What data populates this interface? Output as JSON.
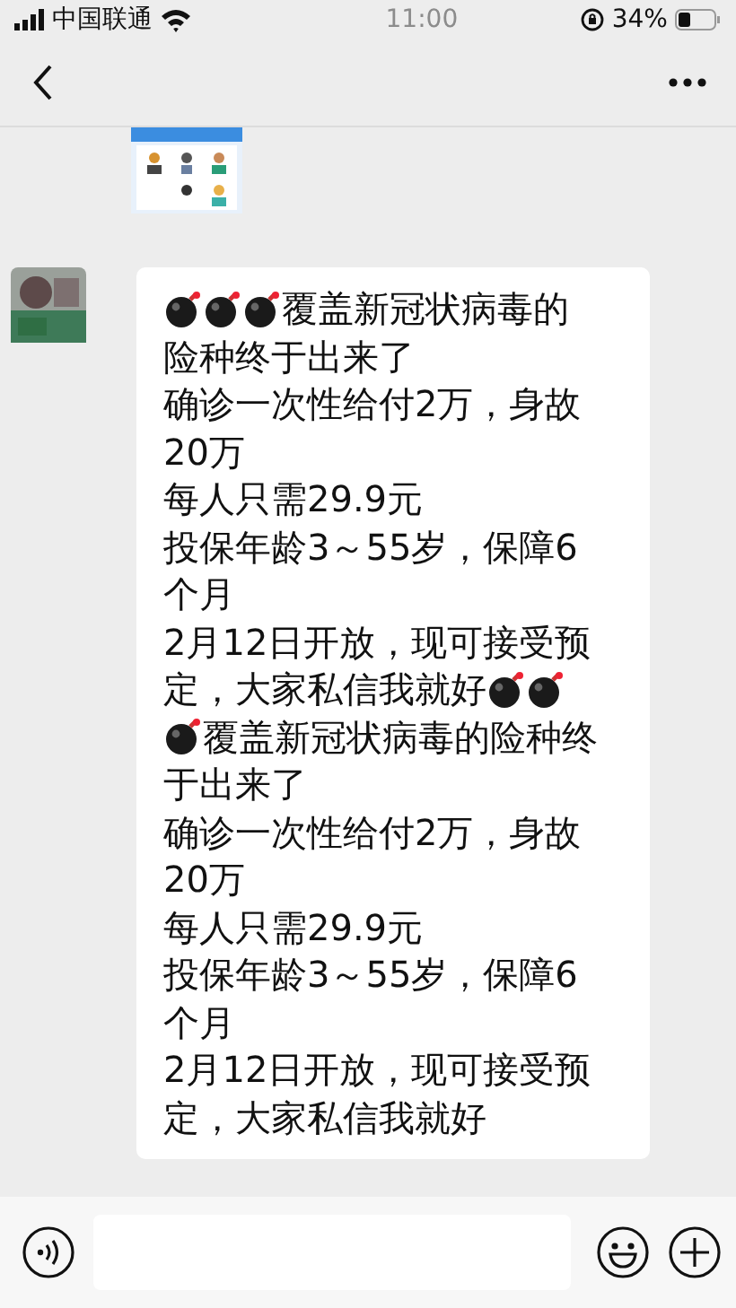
{
  "status_bar": {
    "carrier": "中国联通",
    "time": "11:00",
    "battery": "34%"
  },
  "chat": {
    "shared_image": {
      "kind": "picture"
    },
    "sender_avatar": {
      "kind": "picture"
    },
    "message_lines": [
      [
        {
          "kind": "bomb"
        },
        {
          "kind": "bomb"
        },
        {
          "kind": "bomb"
        },
        {
          "kind": "text",
          "text": "覆盖新冠状病毒的"
        }
      ],
      [
        {
          "kind": "text",
          "text": "险种终于出来了"
        }
      ],
      [
        {
          "kind": "text",
          "text": "确诊一次性给付2万，身故"
        }
      ],
      [
        {
          "kind": "text",
          "text": "20万"
        }
      ],
      [
        {
          "kind": "text",
          "text": "每人只需29.9元"
        }
      ],
      [
        {
          "kind": "text",
          "text": "投保年龄3～55岁，保障6"
        }
      ],
      [
        {
          "kind": "text",
          "text": "个月"
        }
      ],
      [
        {
          "kind": "text",
          "text": "2月12日开放，现可接受预"
        }
      ],
      [
        {
          "kind": "text",
          "text": "定，大家私信我就好"
        },
        {
          "kind": "bomb"
        },
        {
          "kind": "bomb"
        }
      ],
      [
        {
          "kind": "bomb"
        },
        {
          "kind": "text",
          "text": "覆盖新冠状病毒的险种终"
        }
      ],
      [
        {
          "kind": "text",
          "text": "于出来了"
        }
      ],
      [
        {
          "kind": "text",
          "text": "确诊一次性给付2万，身故"
        }
      ],
      [
        {
          "kind": "text",
          "text": "20万"
        }
      ],
      [
        {
          "kind": "text",
          "text": "每人只需29.9元"
        }
      ],
      [
        {
          "kind": "text",
          "text": "投保年龄3～55岁，保障6"
        }
      ],
      [
        {
          "kind": "text",
          "text": "个月"
        }
      ],
      [
        {
          "kind": "text",
          "text": "2月12日开放，现可接受预"
        }
      ],
      [
        {
          "kind": "text",
          "text": "定，大家私信我就好"
        }
      ]
    ]
  }
}
